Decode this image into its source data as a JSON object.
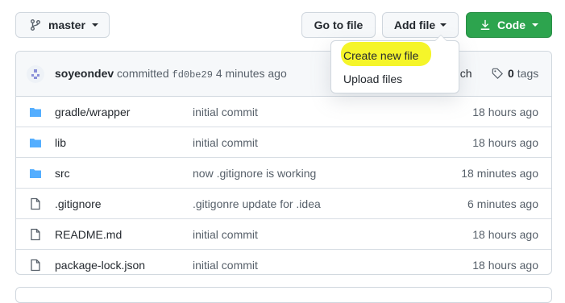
{
  "toolbar": {
    "branch_label": "master",
    "go_to_file_label": "Go to file",
    "add_file_label": "Add file",
    "code_label": "Code"
  },
  "commit": {
    "author": "soyeondev",
    "verb": "committed",
    "sha": "fd0be29",
    "time": "4 minutes ago",
    "branch_partial": "nch",
    "tags_count": "0",
    "tags_label": "tags"
  },
  "dropdown": {
    "items": [
      {
        "label": "Create new file"
      },
      {
        "label": "Upload files"
      }
    ],
    "highlight_color": "#f5f52a"
  },
  "files": [
    {
      "type": "folder",
      "name_prefix": "gradle/",
      "name": "wrapper",
      "message": "initial commit",
      "age": "18 hours ago"
    },
    {
      "type": "folder",
      "name_prefix": "",
      "name": "lib",
      "message": "initial commit",
      "age": "18 hours ago"
    },
    {
      "type": "folder",
      "name_prefix": "",
      "name": "src",
      "message": "now .gitignore is working",
      "age": "18 minutes ago"
    },
    {
      "type": "file",
      "name_prefix": "",
      "name": ".gitignore",
      "message": ".gitigonre update for .idea",
      "age": "6 minutes ago"
    },
    {
      "type": "file",
      "name_prefix": "",
      "name": "README.md",
      "message": "initial commit",
      "age": "18 hours ago"
    },
    {
      "type": "file",
      "name_prefix": "",
      "name": "package-lock.json",
      "message": "initial commit",
      "age": "18 hours ago"
    }
  ],
  "icons": {
    "branch": "git-branch-icon",
    "download": "download-icon",
    "tag": "tag-icon",
    "folder": "folder-icon",
    "file": "file-icon"
  },
  "colors": {
    "code_button": "#2da44e",
    "folder": "#54aeff"
  }
}
